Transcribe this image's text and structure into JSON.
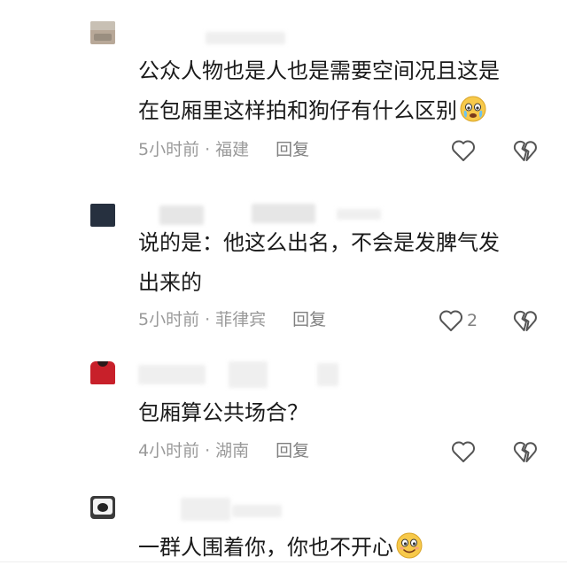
{
  "comments": [
    {
      "text_lines": [
        "公众人物也是人也是需要空间况且这是",
        "在包厢里这样拍和狗仔有什么区别"
      ],
      "emoji": "crying-face-emoji",
      "time": "5小时前",
      "location": "福建",
      "reply_label": "回复",
      "like_count": ""
    },
    {
      "text_lines": [
        "说的是：他这么出名，不会是发脾气发",
        "出来的"
      ],
      "time": "5小时前",
      "location": "菲律宾",
      "reply_label": "回复",
      "like_count": "2"
    },
    {
      "text_lines": [
        "包厢算公共场合？"
      ],
      "time": "4小时前",
      "location": "湖南",
      "reply_label": "回复",
      "like_count": ""
    },
    {
      "text_lines": [
        "一群人围着你，你也不开心"
      ],
      "emoji": "smiling-face-emoji"
    }
  ],
  "colors": {
    "text": "#1a1a1a",
    "meta": "#9a9a9a",
    "icon": "#555555"
  },
  "meta_separator": "·"
}
